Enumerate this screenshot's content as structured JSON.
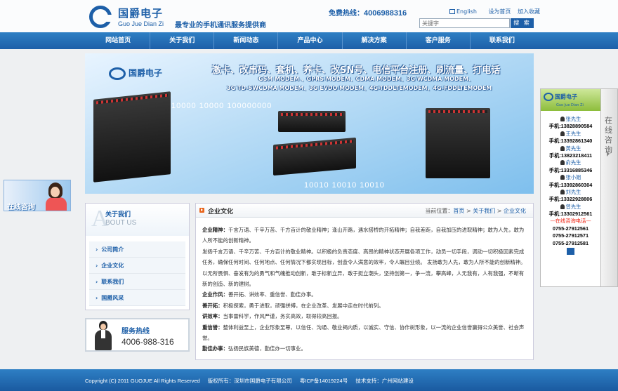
{
  "header": {
    "logo_cn": "国爵电子",
    "logo_py": "Guo Jue Dian Zi",
    "slogan": "最专业的手机通讯服务提供商",
    "hotline_label": "免费热线：",
    "hotline_number": "4006988316",
    "links": {
      "english": "English",
      "home": "设为首页",
      "favorite": "加入收藏"
    },
    "search_placeholder": "关键字",
    "search_button": "搜 索"
  },
  "nav": [
    "网站首页",
    "关于我们",
    "新闻动态",
    "产品中心",
    "解决方案",
    "客户服务",
    "联系我们"
  ],
  "banner": {
    "logo": "国爵电子",
    "line1": "激卡、改串码、套机、养卡、改SN号、电信平台注册、刷流量、打电话",
    "line2": "GSM MODEM 、GPRS MODEM、CDMA MODEM、3G WCDMA MODEM、",
    "line3": "3G TD-SWCDMA MODEM、3G EVDO MODEM、4G-TDDLTEMODEM、4G-FDDLTEMODEM",
    "numbers_top": "10000    10000    100000000",
    "numbers_bottom": "10010    10010    10010"
  },
  "sidebar": {
    "about_big": "A",
    "about_cn": "关于我们",
    "about_en": "BOUT US",
    "items": [
      "公司简介",
      "企业文化",
      "联系我们",
      "国爵风采"
    ],
    "service_title": "服务热线",
    "service_number": "4006-988-316"
  },
  "main": {
    "title": "企业文化",
    "crumb_label": "当前位置：",
    "crumb_home": "首页",
    "crumb_sep": " > ",
    "crumb_about": "关于我们",
    "crumb_current": "企业文化",
    "paragraphs": [
      {
        "label": "企业精神：",
        "text": "千言万语、千辛万苦、千方百计的敬业精神；逢山开路，遇水搭桥的开拓精神；自我差距，自我加压的进取精神；敢为人先，敢为人所不能的创新精神。"
      },
      {
        "label": "",
        "text": "发扬千言万语、千辛万苦、千方百计的敬业精神。以积极的负责态度、高昂的精神状态开展各项工作，动员一切手段，调动一切积极因素完成任务，确保任何时间、任何地点、任何情况下都实现目标，创造令人满意的效率，令人瞩目业绩。 发扬敢为人先，敢为人所不能的创新精神。以无所畏惧、奋发有为的勇气和气魄推动创新，敢于标新立异，敢于挺立潮头，坚持创第一，争一流，攀高峰，人无我有，人有我强，不断有新的创造、新的建树。"
      },
      {
        "label": "企业作风：",
        "text": "善开拓、讲效率、重信誉、勤佳办事。"
      },
      {
        "label": "善开拓：",
        "text": "积极探索，勇于进取，顽强拼搏，在企业改革、发展中走在时代前列。"
      },
      {
        "label": "讲效率：",
        "text": "当事雷科学，作风严谨，务实高效，取得较高回报。"
      },
      {
        "label": "重信誉：",
        "text": "整体利益至上，企业形象至尊，以信任、沟通、敬业揭内质，以诚实、守信、协作树形象，以一流的企业信誉赢得公众美誉、社会声誉。"
      },
      {
        "label": "勤佳办事：",
        "text": "弘扬民族美德，勤佳办一切事业。"
      }
    ]
  },
  "float_left": {
    "text": "在线咨询"
  },
  "right_panel": {
    "logo": "国爵电子",
    "logo_sub": "Guo Jue Dian Zi",
    "tab_text": "在线咨询",
    "contacts": [
      {
        "name": "张先生",
        "phone": "手机:13828890584"
      },
      {
        "name": "王先生",
        "phone": "手机:13392861340"
      },
      {
        "name": "黄先生",
        "phone": "手机:13823218411"
      },
      {
        "name": "俞先生",
        "phone": "手机:13316885346"
      },
      {
        "name": "张小姐",
        "phone": "手机:13392860304"
      },
      {
        "name": "刘先生",
        "phone": "手机:13322928806"
      },
      {
        "name": "曾先生",
        "phone": "手机:13302912561"
      }
    ],
    "tel_label": "—在线咨询电话—",
    "tels": [
      "0755-27912561",
      "0755-27912571",
      "0755-27912581"
    ]
  },
  "footer": {
    "copyright": "Copyright (C) 2011 GUOJUE All Rights Reserved",
    "owner": "版权所有：深圳市国爵电子有限公司",
    "icp": "粤ICP备14019224号",
    "support": "技术支持：广州网站建设"
  }
}
